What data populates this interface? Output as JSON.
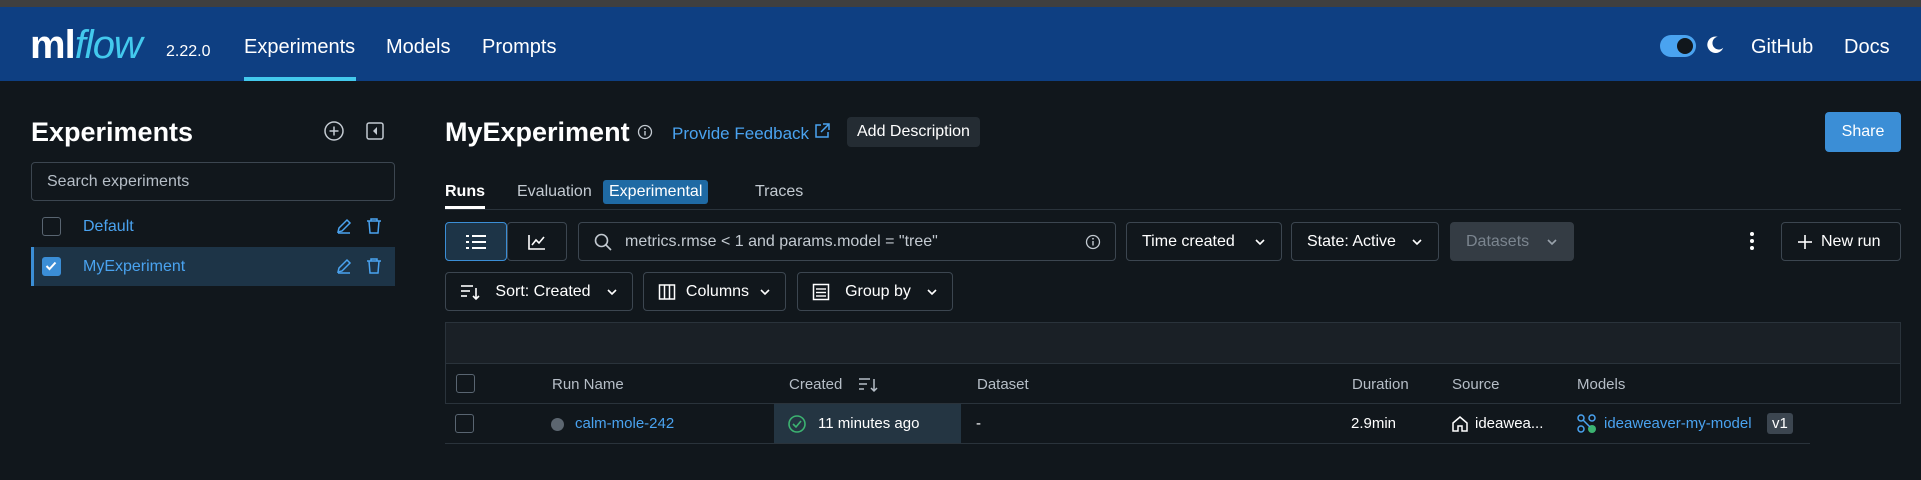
{
  "header": {
    "logo_ml": "ml",
    "logo_flow": "flow",
    "version": "2.22.0",
    "nav": [
      "Experiments",
      "Models",
      "Prompts"
    ],
    "links": [
      "GitHub",
      "Docs"
    ],
    "accent": "#43c9ed",
    "background": "#0e3f82"
  },
  "sidebar": {
    "title": "Experiments",
    "search_placeholder": "Search experiments",
    "experiments": [
      {
        "label": "Default",
        "checked": false
      },
      {
        "label": "MyExperiment",
        "checked": true
      }
    ]
  },
  "main": {
    "title": "MyExperiment",
    "feedback_link": "Provide Feedback",
    "add_description": "Add Description",
    "share": "Share",
    "tabs": [
      "Runs",
      "Evaluation",
      "Traces"
    ],
    "experimental_badge": "Experimental",
    "search_query": "metrics.rmse < 1 and params.model = \"tree\"",
    "time_created": "Time created",
    "state": "State: Active",
    "datasets": "Datasets",
    "new_run": "New run",
    "sort": "Sort: Created",
    "columns": "Columns",
    "group_by": "Group by"
  },
  "table": {
    "headers": [
      "Run Name",
      "Created",
      "Dataset",
      "Duration",
      "Source",
      "Models"
    ],
    "rows": [
      {
        "run_name": "calm-mole-242",
        "created": "11 minutes ago",
        "dataset": "-",
        "duration": "2.9min",
        "source": "ideawea...",
        "model": "ideaweaver-my-model",
        "model_version": "v1"
      }
    ]
  },
  "colors": {
    "link": "#4aa3f0",
    "primary_button": "#3b8ed6",
    "page_background": "#11171c"
  }
}
